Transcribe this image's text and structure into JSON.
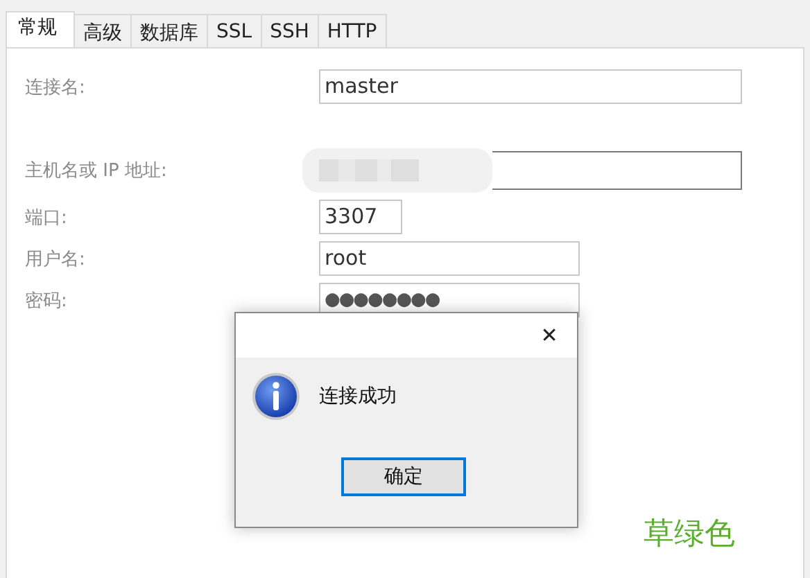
{
  "tabs": [
    {
      "label": "常规",
      "selected": true
    },
    {
      "label": "高级",
      "selected": false
    },
    {
      "label": "数据库",
      "selected": false
    },
    {
      "label": "SSL",
      "selected": false
    },
    {
      "label": "SSH",
      "selected": false
    },
    {
      "label": "HTTP",
      "selected": false
    }
  ],
  "form": [
    {
      "label": "连接名:",
      "kind": "text",
      "value": "master"
    },
    {
      "label": "主机名或 IP 地址:",
      "kind": "redacted"
    },
    {
      "label": "端口:",
      "kind": "text",
      "value": "3307"
    },
    {
      "label": "用户名:",
      "kind": "text",
      "value": "root"
    },
    {
      "label": "密码:",
      "kind": "password",
      "value": "●●●●●●●●"
    }
  ],
  "dialog": {
    "message": "连接成功",
    "button": "确定",
    "close": "✕"
  },
  "annotation": "草绿色"
}
